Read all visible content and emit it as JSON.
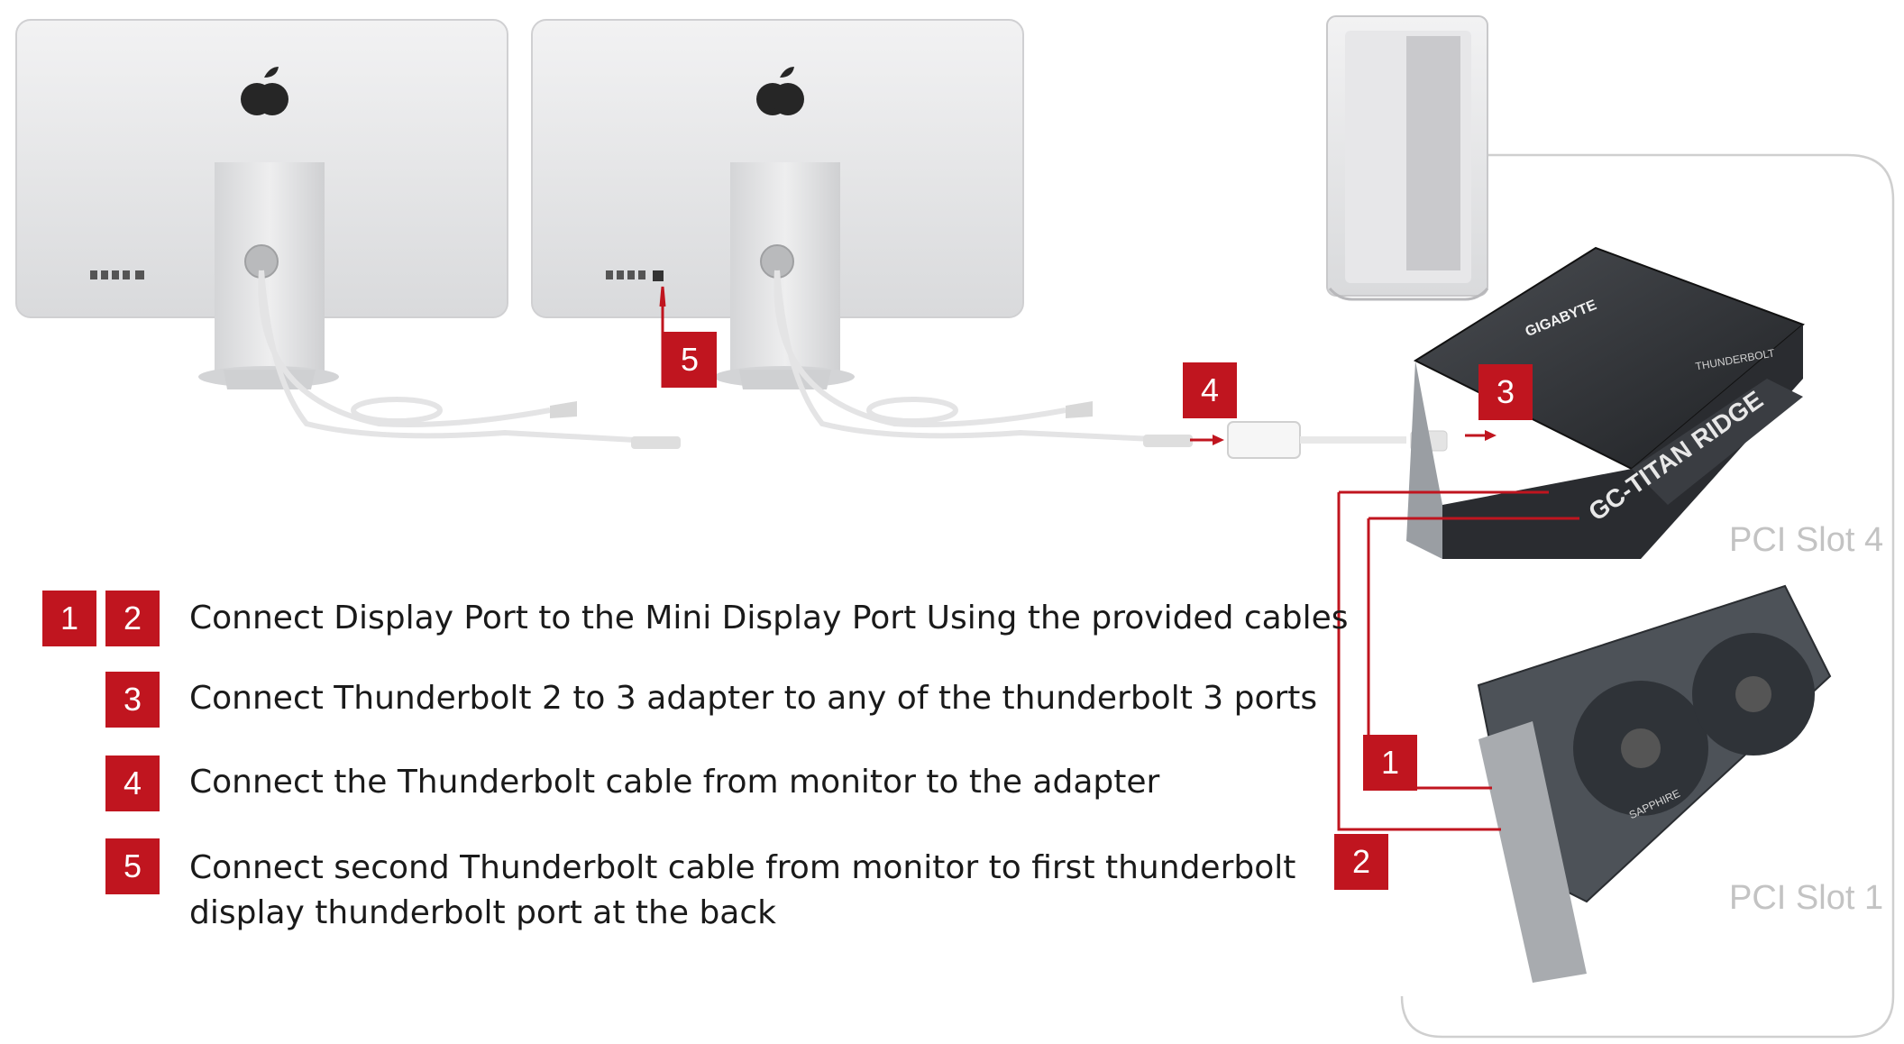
{
  "steps": [
    {
      "badges": [
        "1",
        "2"
      ],
      "text": "Connect Display Port to the Mini Display Port Using the provided cables"
    },
    {
      "badges": [
        "3"
      ],
      "text": "Connect Thunderbolt 2 to 3 adapter to any of the thunderbolt 3 ports"
    },
    {
      "badges": [
        "4"
      ],
      "text": "Connect the Thunderbolt cable from monitor to the adapter"
    },
    {
      "badges": [
        "5"
      ],
      "text_line1": "Connect second Thunderbolt cable from monitor to first thunderbolt",
      "text_line2": "display thunderbolt port at the back"
    }
  ],
  "diagram": {
    "callout_5": "5",
    "callout_4": "4",
    "callout_3": "3",
    "callout_1": "1",
    "callout_2": "2",
    "slot_top": "PCI Slot 4",
    "slot_bottom": "PCI Slot 1",
    "card_brand": "GIGABYTE",
    "card_model": "GC-TITAN RIDGE",
    "card_tb": "THUNDERBOLT",
    "gpu_brand": "SAPPHIRE"
  },
  "colors": {
    "accent": "#c0151f",
    "slot_text": "#c3c3c3",
    "frame": "#cfcfcf"
  }
}
